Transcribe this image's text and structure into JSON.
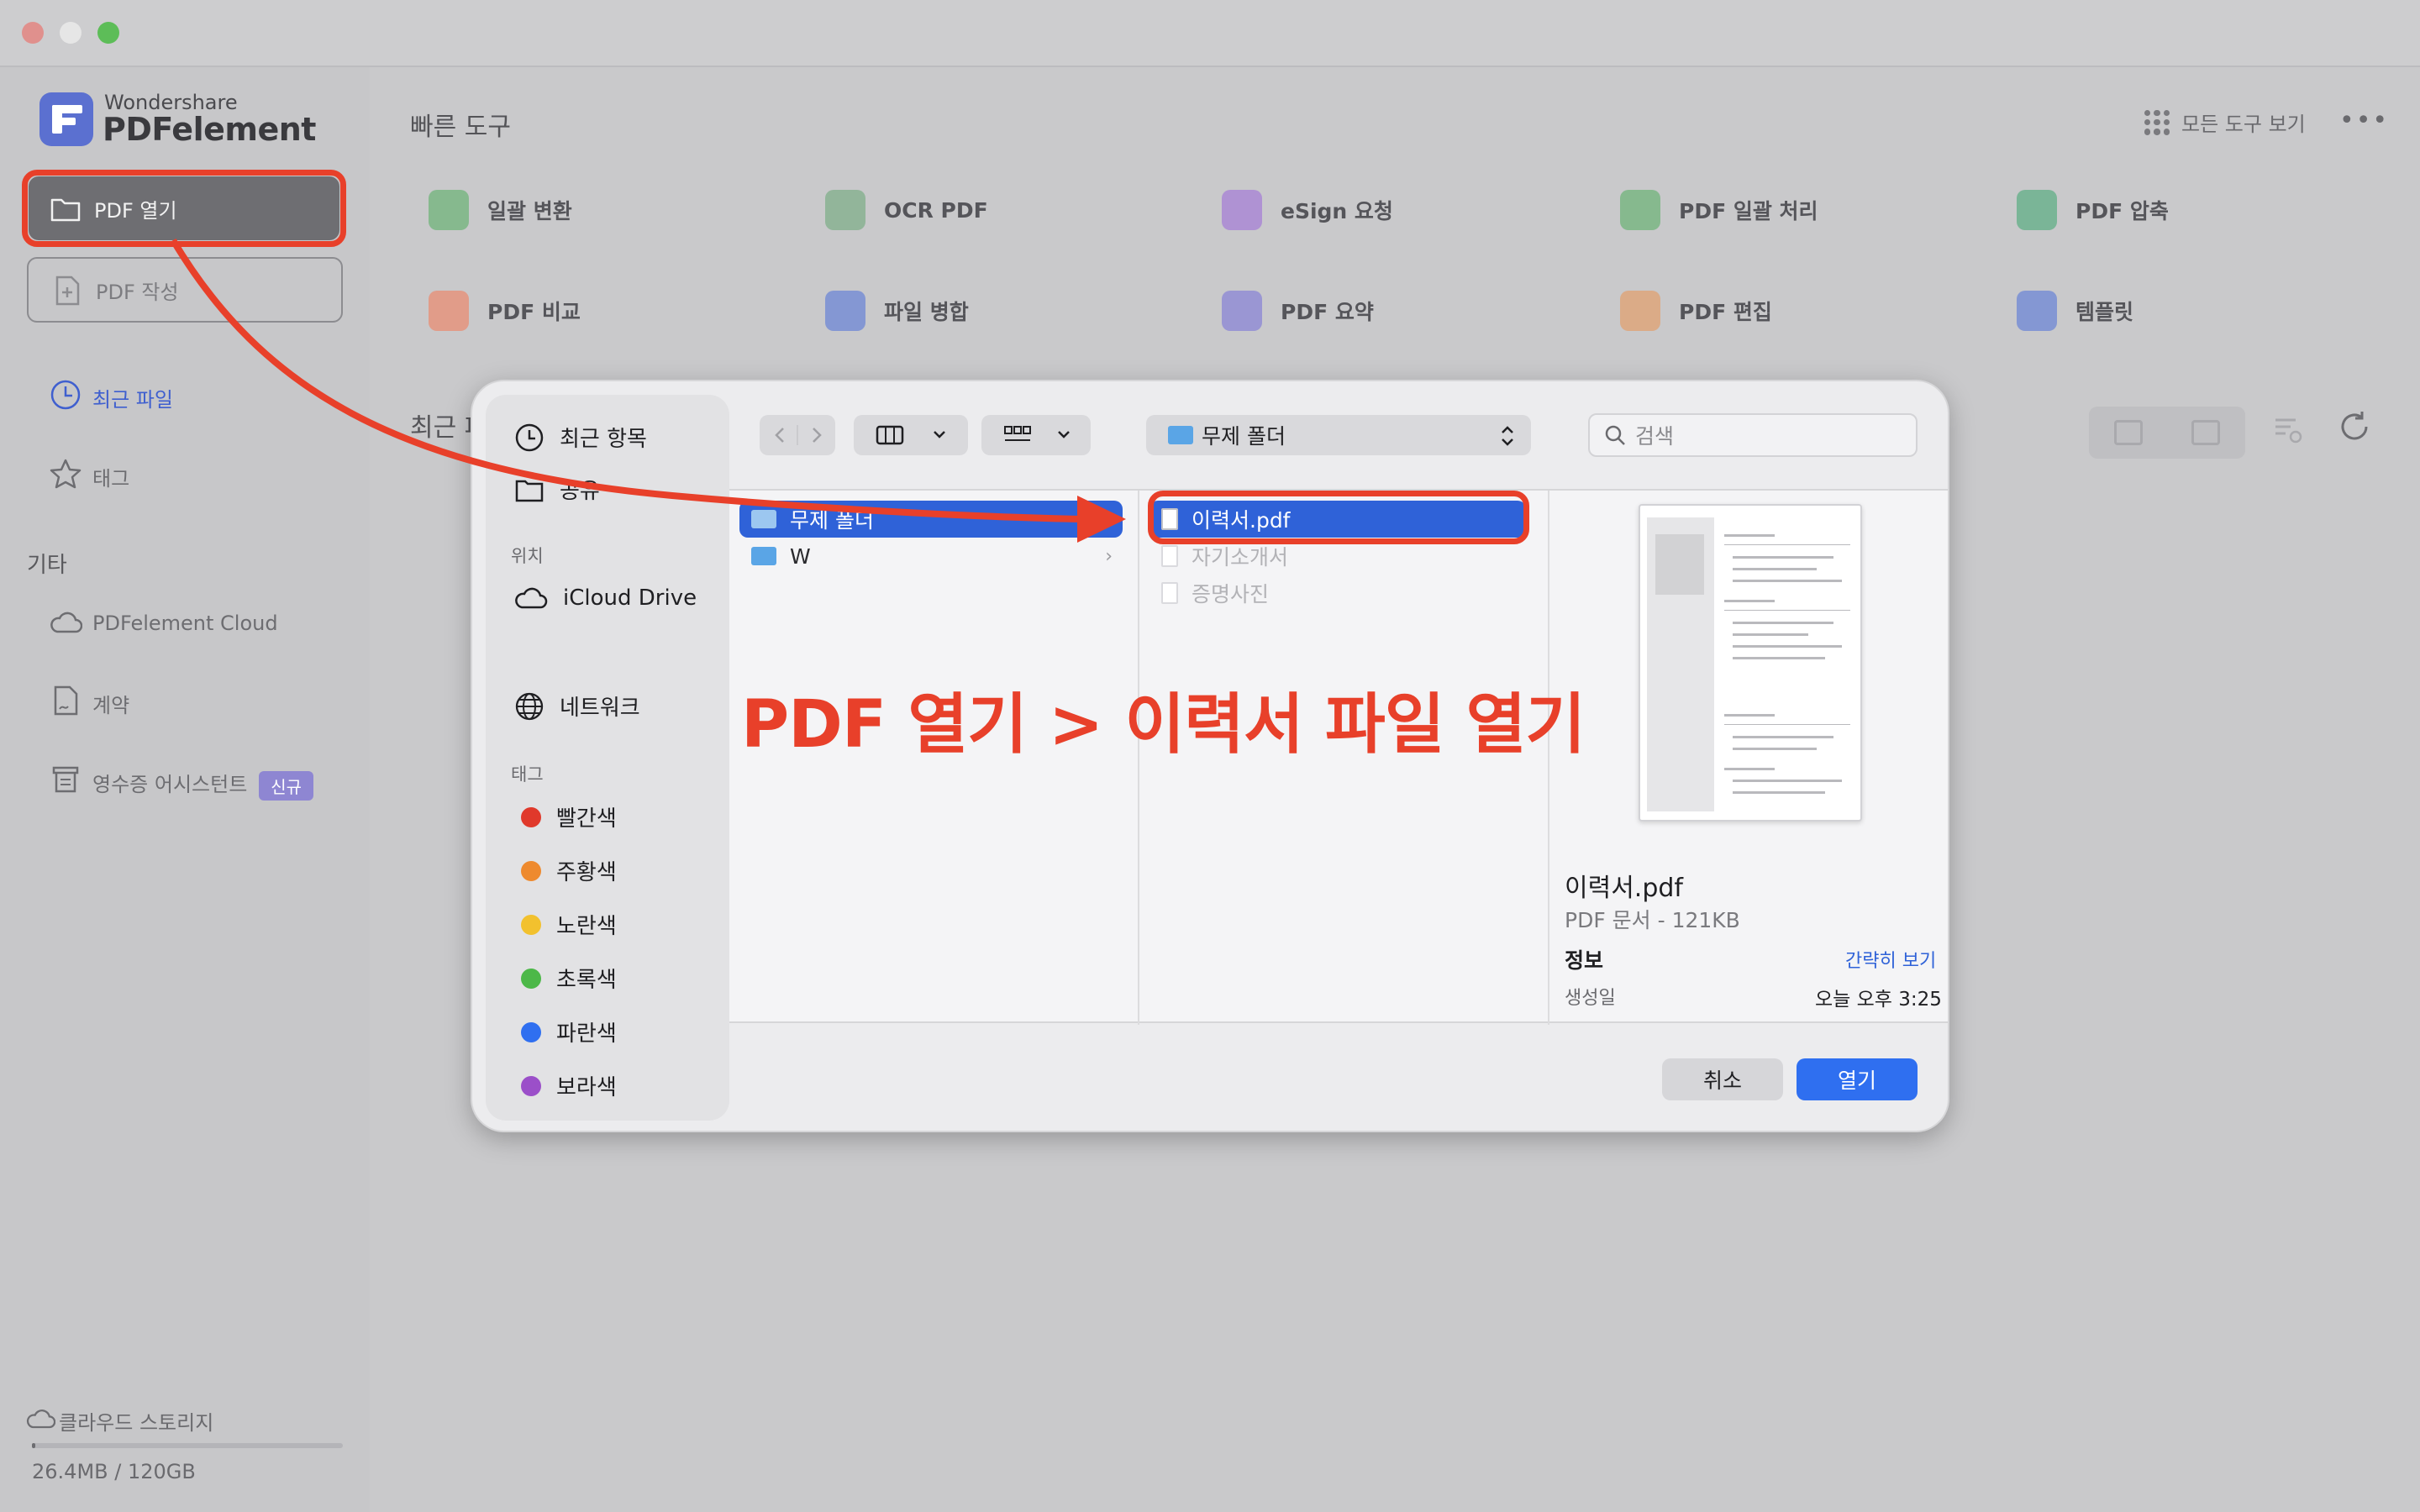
{
  "app": {
    "brand_small": "Wondershare",
    "brand_big": "PDFelement"
  },
  "sidebar": {
    "open_pdf": "PDF 열기",
    "create_pdf": "PDF 작성",
    "recent_files": "최근 파일",
    "tags": "태그",
    "other_section": "기타",
    "cloud": "PDFelement Cloud",
    "contract": "계약",
    "receipt": "영수증 어시스턴트",
    "receipt_badge": "신규",
    "storage_label": "클라우드 스토리지",
    "storage_value": "26.4MB / 120GB",
    "storage_used_fraction": 0.0002
  },
  "main": {
    "quick_tools_title": "빠른 도구",
    "all_tools": "모든 도구 보기",
    "more": "•••",
    "recent_title": "최근 파",
    "tools": [
      {
        "label": "일괄 변환",
        "color": "#6fb37a"
      },
      {
        "label": "OCR PDF",
        "color": "#7fae8a"
      },
      {
        "label": "eSign 요청",
        "color": "#a57fd6"
      },
      {
        "label": "PDF 일괄 처리",
        "color": "#6fb37a"
      },
      {
        "label": "PDF 압축",
        "color": "#5fae86"
      },
      {
        "label": "PDF 비교",
        "color": "#e88c73"
      },
      {
        "label": "파일 병합",
        "color": "#6c86d6"
      },
      {
        "label": "PDF 요약",
        "color": "#8a84d6"
      },
      {
        "label": "PDF 편집",
        "color": "#e0a070"
      },
      {
        "label": "템플릿",
        "color": "#6c86d6"
      }
    ]
  },
  "dialog": {
    "sidebar": {
      "recents": "최근 항목",
      "shared": "공유",
      "location_label": "위치",
      "icloud": "iCloud Drive",
      "network": "네트워크",
      "tags_label": "태그",
      "tags": [
        {
          "label": "빨간색",
          "color": "#e0392b"
        },
        {
          "label": "주황색",
          "color": "#ee8a2e"
        },
        {
          "label": "노란색",
          "color": "#f2c12e"
        },
        {
          "label": "초록색",
          "color": "#4cb848"
        },
        {
          "label": "파란색",
          "color": "#2f6ff0"
        },
        {
          "label": "보라색",
          "color": "#9b4fc9"
        }
      ]
    },
    "path": "무제 폴더",
    "search_placeholder": "검색",
    "col1": [
      "무제 폴더",
      "W"
    ],
    "col2": [
      "이력서.pdf",
      "자기소개서",
      "증명사진"
    ],
    "preview": {
      "name": "이력서.pdf",
      "meta": "PDF 문서 - 121KB",
      "info_title": "정보",
      "info_link": "간략히 보기",
      "created_label": "생성일",
      "created_value": "오늘 오후 3:25"
    },
    "cancel": "취소",
    "open": "열기"
  },
  "annotation": {
    "caption": "PDF 열기 > 이력서 파일 열기",
    "color": "#e8402a"
  }
}
